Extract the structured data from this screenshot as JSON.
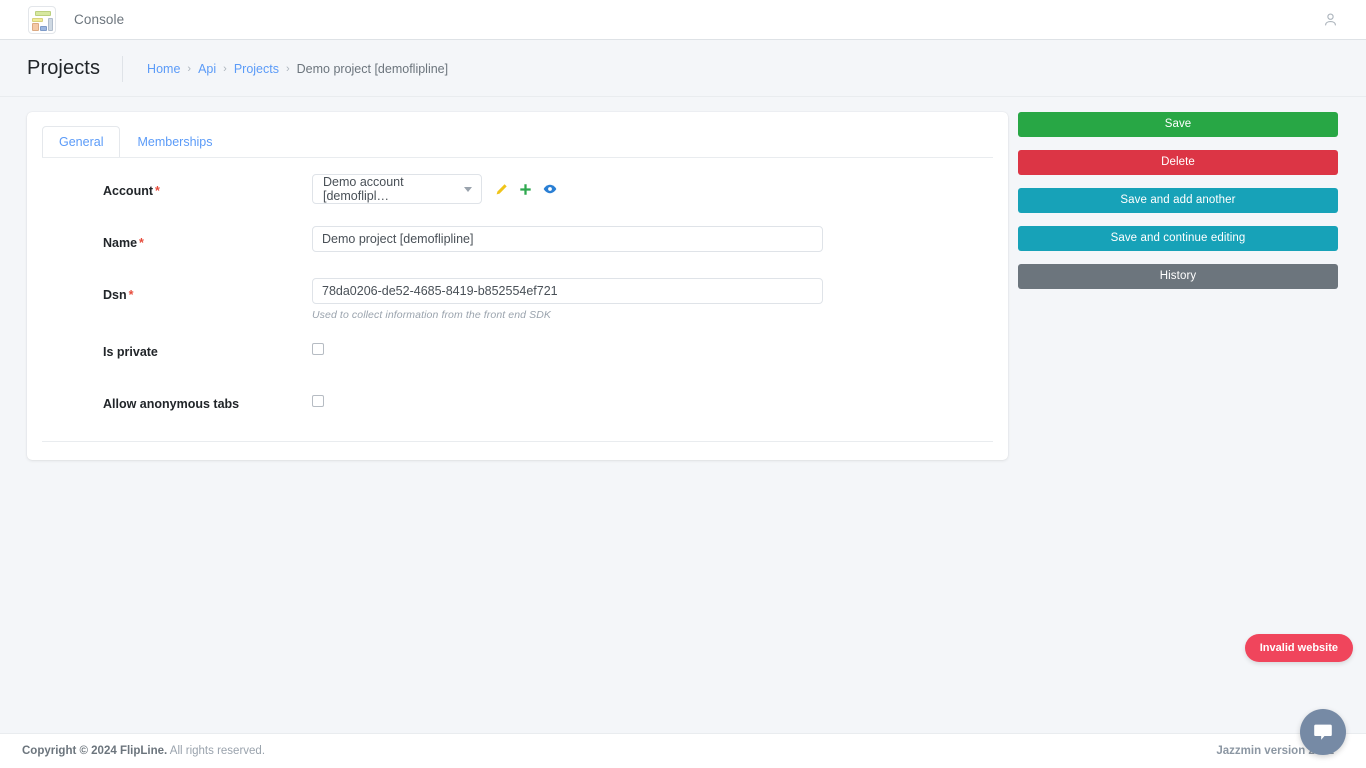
{
  "navbar": {
    "logo_icon": "dashboard-layout-icon",
    "brand_title": "Console",
    "user_icon": "user-account-icon"
  },
  "header": {
    "page_title": "Projects",
    "breadcrumb": [
      {
        "label": "Home",
        "current": false
      },
      {
        "label": "Api",
        "current": false
      },
      {
        "label": "Projects",
        "current": false
      },
      {
        "label": "Demo project [demoflipline]",
        "current": true
      }
    ],
    "breadcrumb_separator": "›"
  },
  "card": {
    "tabs": [
      {
        "label": "General",
        "active": true
      },
      {
        "label": "Memberships",
        "active": false
      }
    ],
    "fields": {
      "account": {
        "label": "Account",
        "required_mark": "*",
        "value": "Demo account [demoflipl…",
        "icons": [
          {
            "name": "edit-pencil-icon",
            "color": "#f0c419"
          },
          {
            "name": "add-plus-icon",
            "color": "#28a745"
          },
          {
            "name": "view-eye-icon",
            "color": "#2a7fd4"
          }
        ]
      },
      "name": {
        "label": "Name",
        "required_mark": "*",
        "value": "Demo project [demoflipline]",
        "placeholder": ""
      },
      "dsn": {
        "label": "Dsn",
        "required_mark": "*",
        "value": "78da0206-de52-4685-8419-b852554ef721",
        "placeholder": "",
        "help_text": "Used to collect information from the front end SDK"
      },
      "is_private": {
        "label": "Is private",
        "checked": false
      },
      "allow_anonymous_tabs": {
        "label": "Allow anonymous tabs",
        "checked": false
      }
    }
  },
  "actions": [
    {
      "label": "Save",
      "color": "#28a745",
      "name": "save-button"
    },
    {
      "label": "Delete",
      "color": "#dc3545",
      "name": "delete-button"
    },
    {
      "label": "Save and add another",
      "color": "#17a2b8",
      "name": "save-and-add-another-button"
    },
    {
      "label": "Save and continue editing",
      "color": "#17a2b8",
      "name": "save-and-continue-editing-button"
    },
    {
      "label": "History",
      "color": "#6c757d",
      "name": "history-button"
    }
  ],
  "floating": {
    "invalid_badge": "Invalid website",
    "chat_icon": "chat-bubble-icon"
  },
  "footer": {
    "copyright_bold": "Copyright © 2024 FlipLine.",
    "copyright_rest": " All rights reserved.",
    "jazzmin_version": "Jazzmin version 2.6.1"
  },
  "colors": {
    "accent_link": "#5b9bf8",
    "page_bg": "#f4f6f9",
    "card_bg": "#ffffff",
    "danger": "#dc3545",
    "success": "#28a745",
    "info": "#17a2b8",
    "secondary": "#6c757d",
    "badge_red": "#f0455c",
    "chat_fab": "#768aa5"
  }
}
